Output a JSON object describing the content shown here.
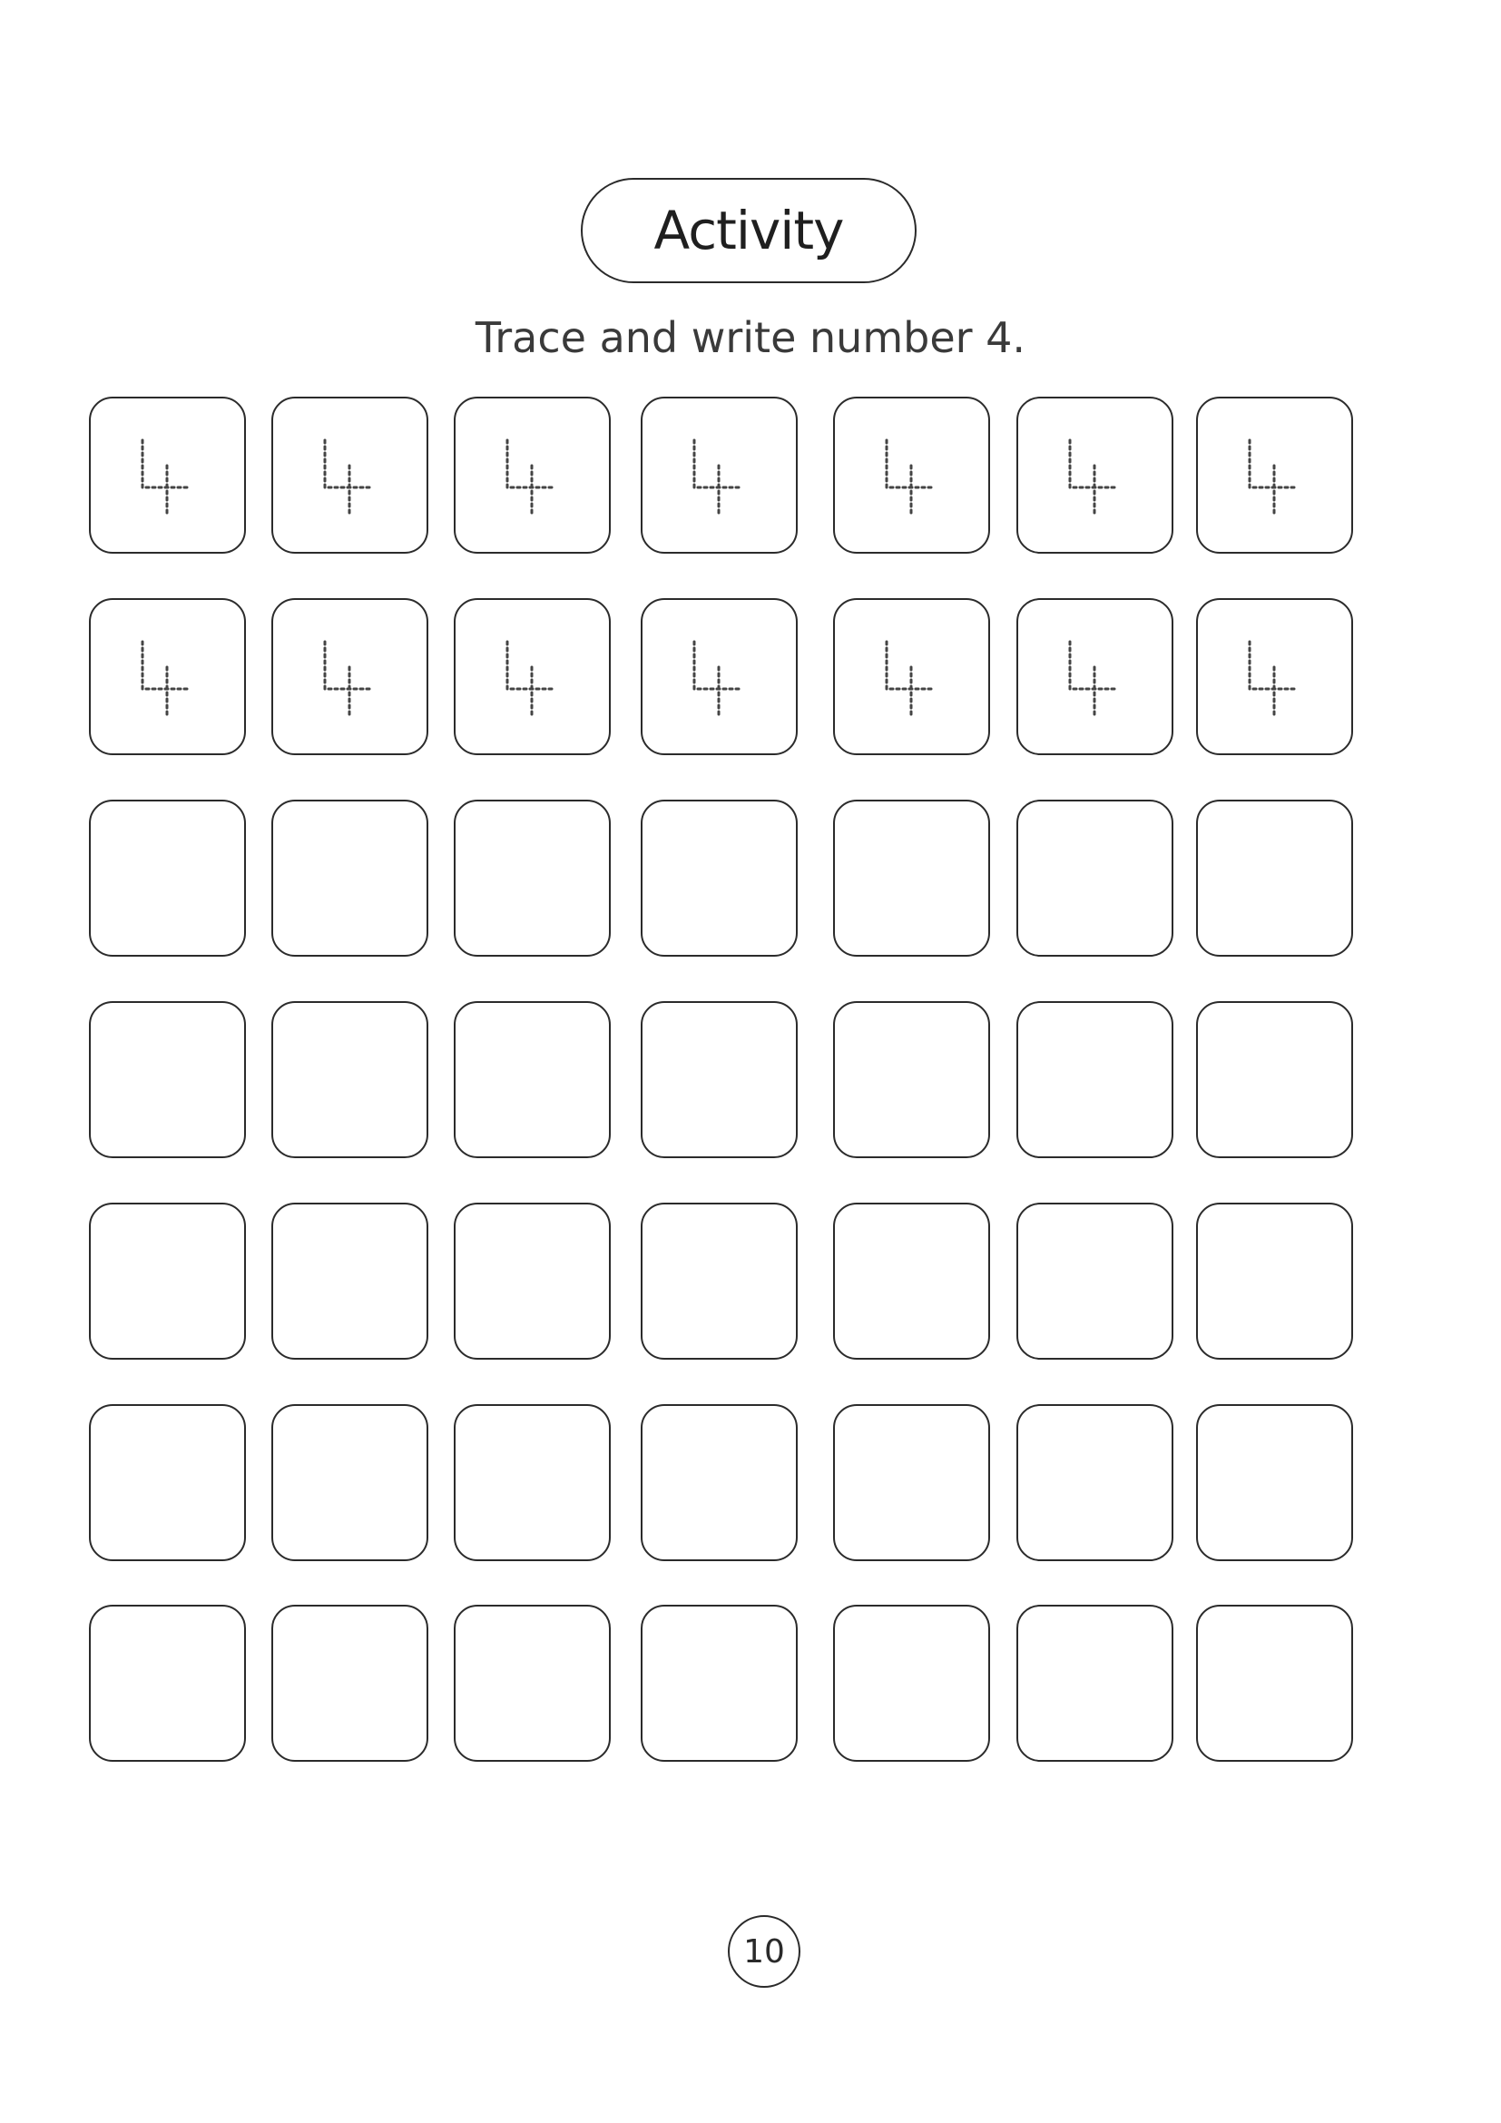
{
  "header": {
    "title": "Activity",
    "instruction": "Trace and write number 4."
  },
  "worksheet": {
    "trace_digit": "4",
    "rows": 7,
    "columns": 7,
    "traced_rows": 2
  },
  "footer": {
    "page_number": "10"
  }
}
